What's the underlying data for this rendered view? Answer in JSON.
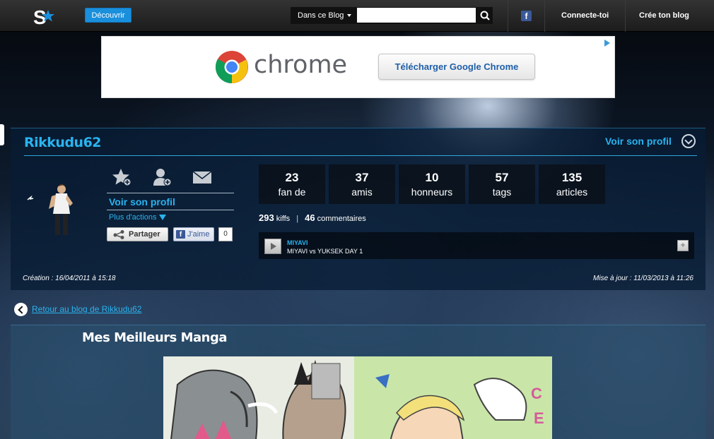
{
  "topbar": {
    "decouvrir": "Découvrir",
    "search_scope": "Dans ce Blog",
    "search_value": "",
    "connect": "Connecte-toi",
    "create": "Crée ton blog"
  },
  "ad": {
    "brand": "chrome",
    "button": "Télécharger Google Chrome"
  },
  "profile": {
    "name": "Rikkudu62",
    "voir_profil_top": "Voir son profil",
    "voir_profil": "Voir son profil",
    "plus_actions": "Plus d'actions",
    "share": "Partager",
    "like": "J'aime",
    "like_count": "0",
    "stats": [
      {
        "n": "23",
        "l": "fan de"
      },
      {
        "n": "37",
        "l": "amis"
      },
      {
        "n": "10",
        "l": "honneurs"
      },
      {
        "n": "57",
        "l": "tags"
      },
      {
        "n": "135",
        "l": "articles"
      }
    ],
    "kiffs": "293",
    "kiffs_label": "kiffs",
    "comments": "46",
    "comments_label": "commentaires",
    "track": {
      "artist": "MIYAVI",
      "title": "MIYAVI vs YUKSEK DAY 1",
      "plus": "+"
    },
    "creation": "Création : 16/04/2011 à 15:18",
    "maj": "Mise à jour : 11/03/2013 à 11:26"
  },
  "back_link": "Retour au blog de Rikkudu62",
  "article": {
    "title": "Mes Meilleurs Manga"
  },
  "colors": {
    "accent": "#2ab3ef",
    "facebook": "#3b5998",
    "button_blue": "#1a8fdc"
  },
  "icons": {
    "logo": "skyrock-star-icon",
    "search": "search-icon",
    "add_fan": "star-plus-icon",
    "add_friend": "user-plus-icon",
    "message": "envelope-icon",
    "share": "share-icon",
    "play": "play-icon",
    "back": "chevron-left-icon"
  }
}
